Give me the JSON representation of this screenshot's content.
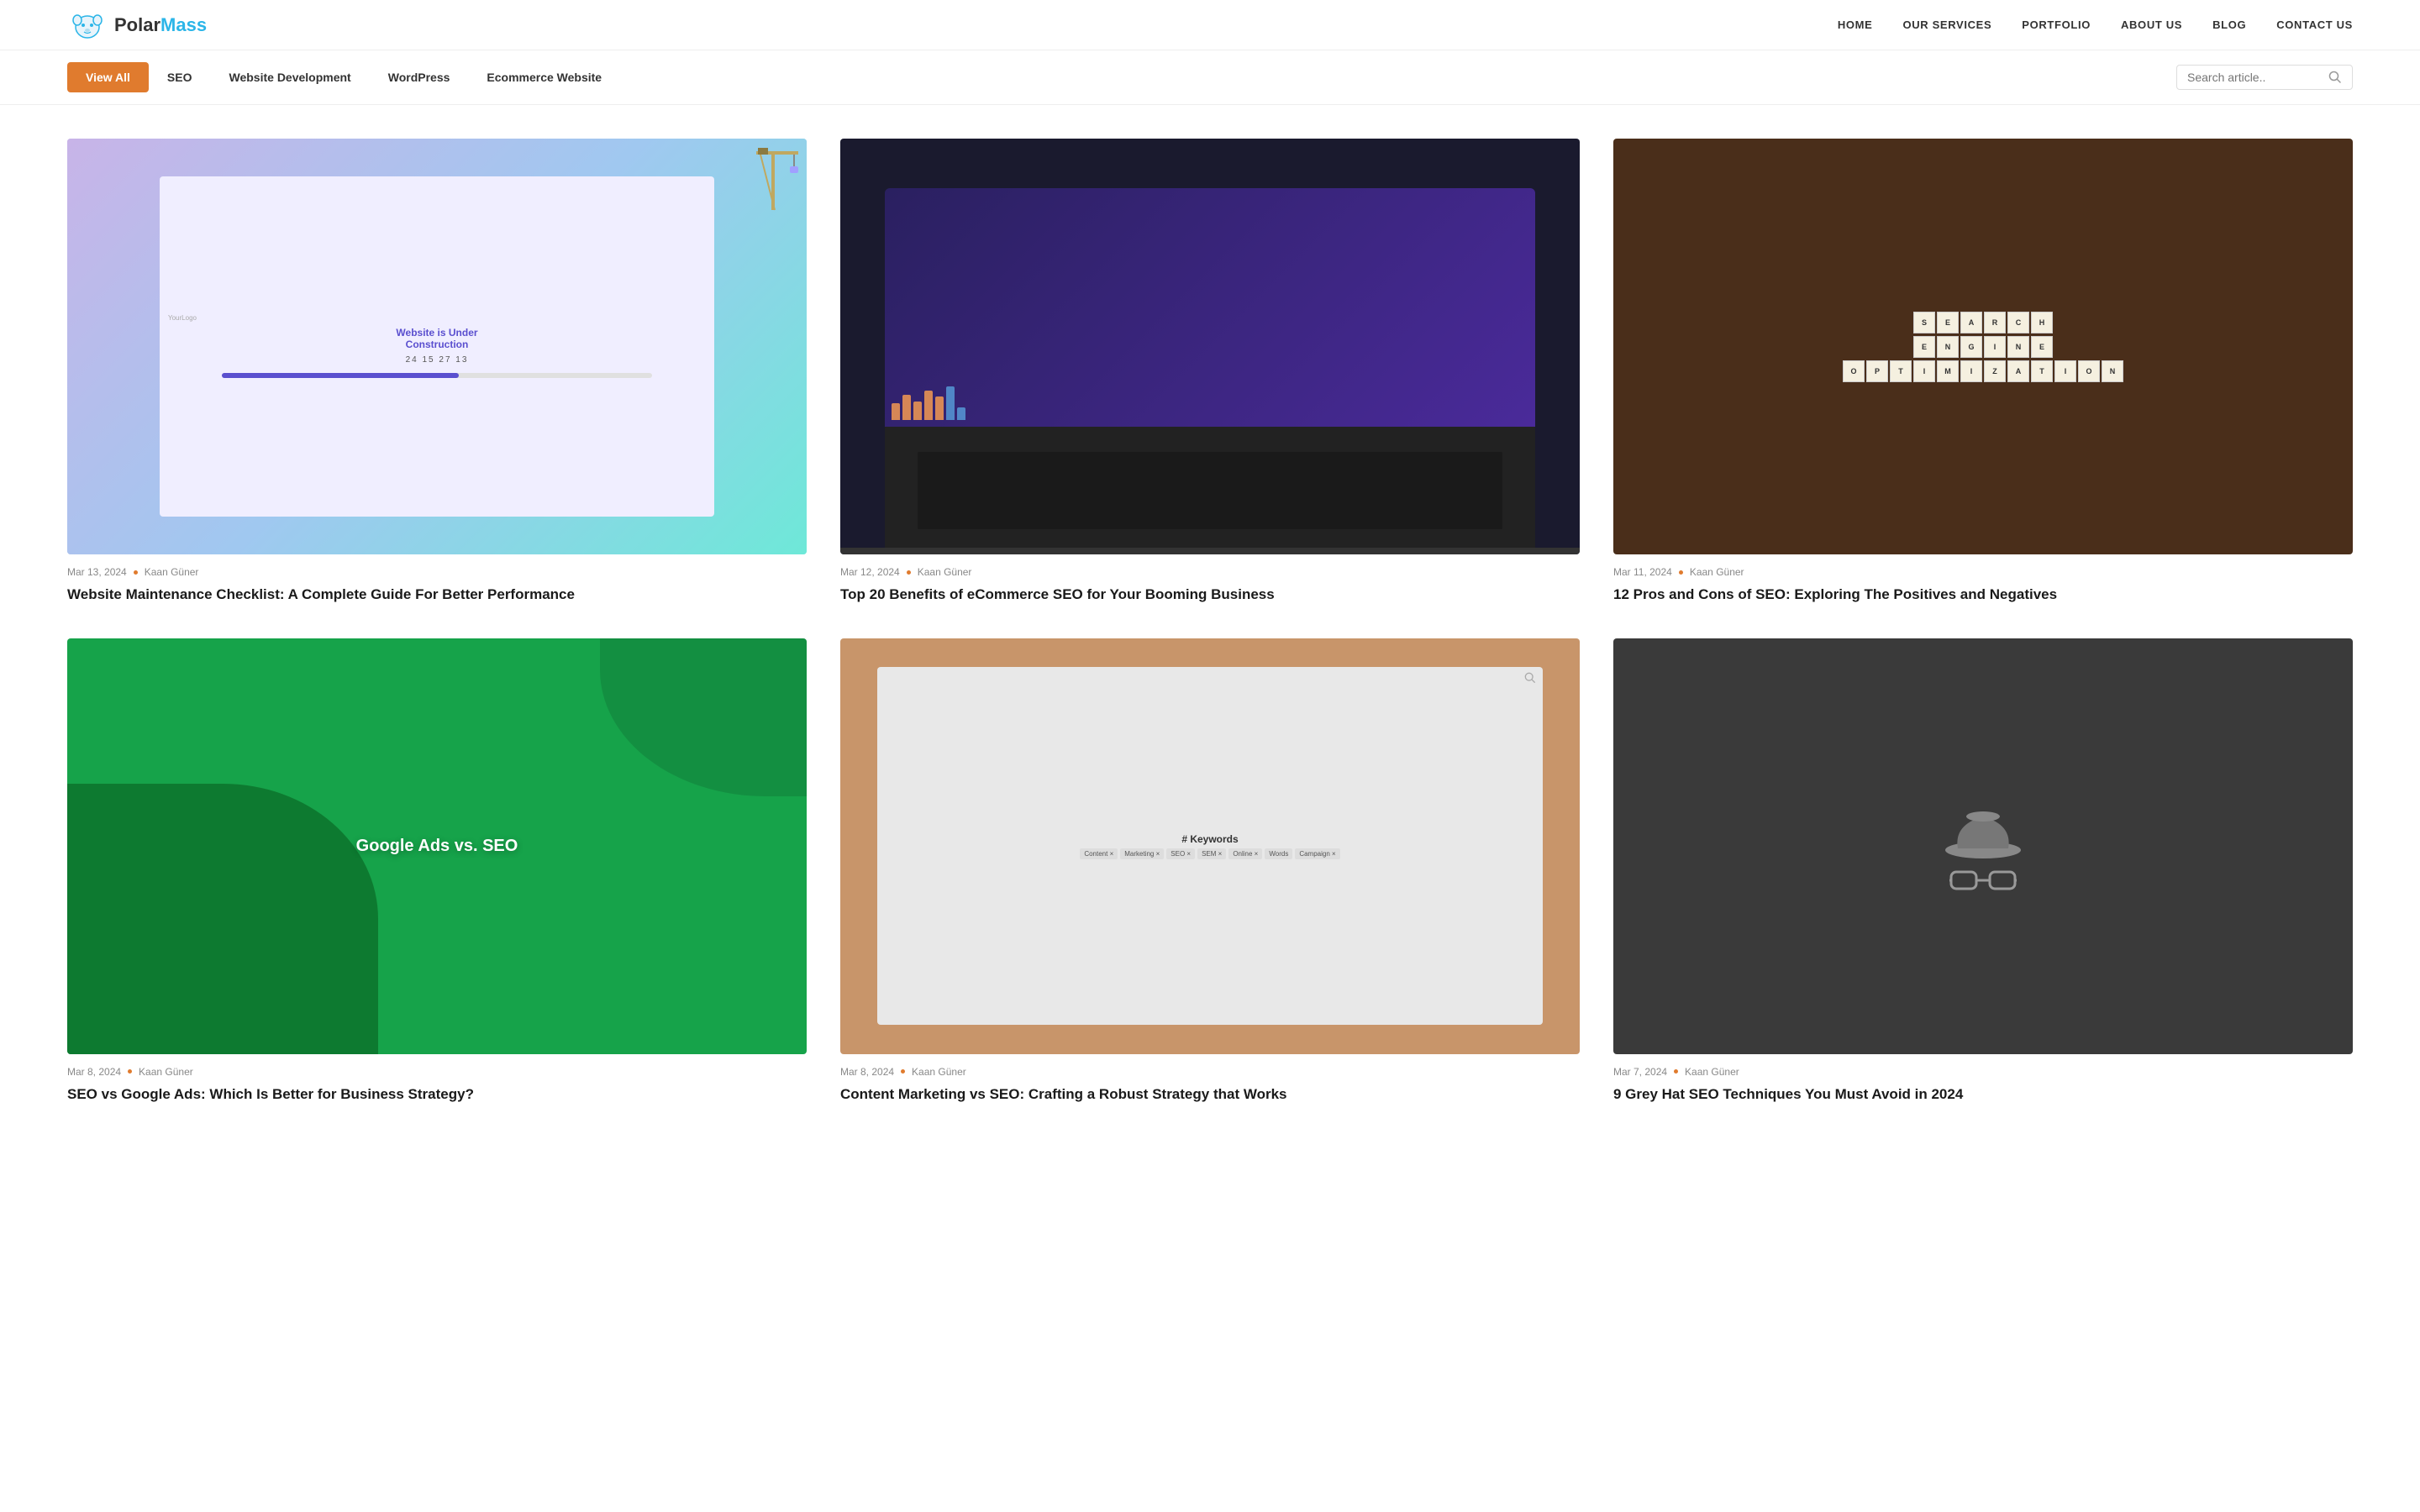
{
  "site": {
    "logo_text_polar": "Polar",
    "logo_text_mass": "Mass"
  },
  "nav": {
    "items": [
      {
        "label": "HOME",
        "href": "#"
      },
      {
        "label": "OUR SERVICES",
        "href": "#"
      },
      {
        "label": "PORTFOLIO",
        "href": "#"
      },
      {
        "label": "ABOUT US",
        "href": "#"
      },
      {
        "label": "BLOG",
        "href": "#"
      },
      {
        "label": "CONTACT US",
        "href": "#"
      }
    ]
  },
  "filters": {
    "buttons": [
      {
        "label": "View All",
        "active": true
      },
      {
        "label": "SEO",
        "active": false
      },
      {
        "label": "Website Development",
        "active": false
      },
      {
        "label": "WordPress",
        "active": false
      },
      {
        "label": "Ecommerce Website",
        "active": false
      }
    ],
    "search_placeholder": "Search article.."
  },
  "articles": [
    {
      "date": "Mar 13, 2024",
      "author": "Kaan Güner",
      "title": "Website Maintenance Checklist: A Complete Guide For Better Performance",
      "thumb_type": "construction"
    },
    {
      "date": "Mar 12, 2024",
      "author": "Kaan Güner",
      "title": "Top 20 Benefits of eCommerce SEO for Your Booming Business",
      "thumb_type": "laptop_dark"
    },
    {
      "date": "Mar 11, 2024",
      "author": "Kaan Güner",
      "title": "12 Pros and Cons of SEO: Exploring The Positives and Negatives",
      "thumb_type": "scrabble"
    },
    {
      "date": "Mar 8, 2024",
      "author": "Kaan Güner",
      "title": "SEO vs Google Ads: Which Is Better for Business Strategy?",
      "thumb_type": "google_ads"
    },
    {
      "date": "Mar 8, 2024",
      "author": "Kaan Güner",
      "title": "Content Marketing vs SEO: Crafting a Robust Strategy that Works",
      "thumb_type": "keywords"
    },
    {
      "date": "Mar 7, 2024",
      "author": "Kaan Güner",
      "title": "9 Grey Hat SEO Techniques You Must Avoid in 2024",
      "thumb_type": "grey_hat"
    }
  ],
  "scrabble_tiles": [
    "S",
    "E",
    "A",
    "R",
    "C",
    "H",
    "E",
    "N",
    "G",
    "I",
    "N",
    "E",
    "O",
    "P",
    "T",
    "I",
    "M",
    "I",
    "Z",
    "A",
    "T",
    "I",
    "O",
    "N"
  ],
  "google_ads_text": "Google Ads vs. SEO",
  "keywords_title": "# Keywords",
  "keyword_list": [
    "Content",
    "Marketing",
    "SEO",
    "SEM",
    "Online",
    "Words",
    "Campaign"
  ]
}
